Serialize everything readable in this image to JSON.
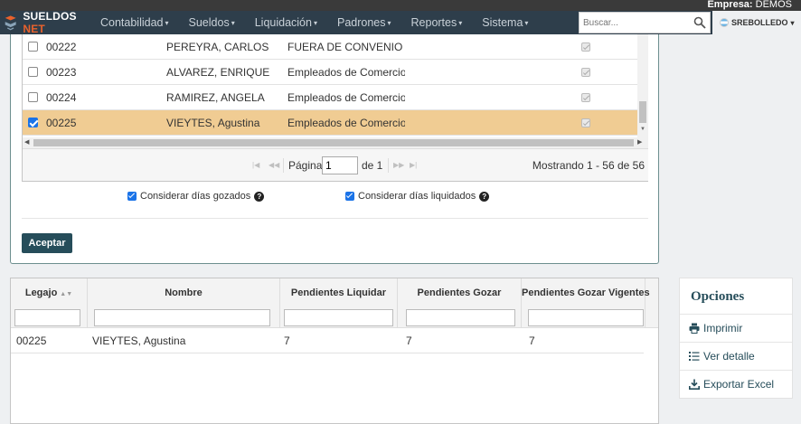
{
  "header": {
    "empresa_label": "Empresa:",
    "empresa_value": "DEMOS",
    "logo_main": "SUELDOS",
    "logo_accent": "NET",
    "menu": [
      {
        "label": "Contabilidad"
      },
      {
        "label": "Sueldos"
      },
      {
        "label": "Liquidación"
      },
      {
        "label": "Padrones"
      },
      {
        "label": "Reportes"
      },
      {
        "label": "Sistema"
      }
    ],
    "search_placeholder": "Buscar...",
    "user": "SREBOLLEDO"
  },
  "employee_grid": {
    "rows": [
      {
        "legajo": "00222",
        "nombre": "PEREYRA, CARLOS",
        "convenio": "FUERA DE CONVENIO",
        "selected": false
      },
      {
        "legajo": "00223",
        "nombre": "ALVAREZ, ENRIQUE",
        "convenio": "Empleados de Comercio - (",
        "selected": false
      },
      {
        "legajo": "00224",
        "nombre": "RAMIREZ, ANGELA",
        "convenio": "Empleados de Comercio - (",
        "selected": false
      },
      {
        "legajo": "00225",
        "nombre": "VIEYTES, Agustina",
        "convenio": "Empleados de Comercio - (",
        "selected": true
      }
    ],
    "pager": {
      "page_label": "Página",
      "page_value": "1",
      "of_label": "de 1",
      "count_text": "Mostrando 1 - 56 de 56"
    }
  },
  "options": {
    "dias_gozados": "Considerar días gozados",
    "dias_liquidados": "Considerar días liquidados",
    "aceptar": "Aceptar"
  },
  "result_table": {
    "columns": [
      "Legajo",
      "Nombre",
      "Pendientes Liquidar",
      "Pendientes Gozar",
      "Pendientes Gozar Vigentes"
    ],
    "rows": [
      {
        "legajo": "00225",
        "nombre": "VIEYTES, Agustina",
        "pend_liquidar": "7",
        "pend_gozar": "7",
        "pend_gozar_vigentes": "7"
      }
    ]
  },
  "sidebar": {
    "title": "Opciones",
    "items": [
      {
        "label": "Imprimir",
        "icon": "print-icon"
      },
      {
        "label": "Ver detalle",
        "icon": "list-icon"
      },
      {
        "label": "Exportar Excel",
        "icon": "download-icon"
      }
    ]
  },
  "colors": {
    "navbar": "#2e3e4b",
    "accent": "#264d5a",
    "selected_row": "#f0cc93",
    "logo_accent": "#e8612c"
  }
}
